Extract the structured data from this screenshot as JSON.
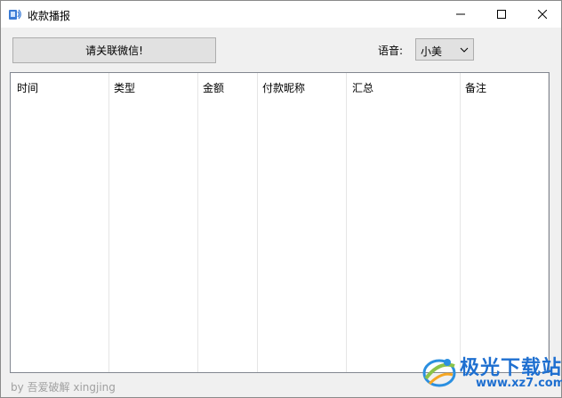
{
  "window": {
    "title": "收款播报",
    "controls": {
      "minimize": "minimize",
      "maximize": "maximize",
      "close": "close"
    }
  },
  "toolbar": {
    "follow_label": "请关联微信!",
    "voice_label": "语音:",
    "voice_value": "小美"
  },
  "table": {
    "columns": [
      "时间",
      "类型",
      "金额",
      "付款昵称",
      "汇总",
      "备注"
    ],
    "rows": []
  },
  "footer": {
    "credit": "by 吾爱破解 xingjing"
  },
  "watermark": {
    "title": "极光下载站",
    "url": "www.xz7.com"
  },
  "colors": {
    "watermark_blue": "#1e6fd0",
    "list_border": "#828790",
    "button_bg": "#e1e1e1"
  }
}
